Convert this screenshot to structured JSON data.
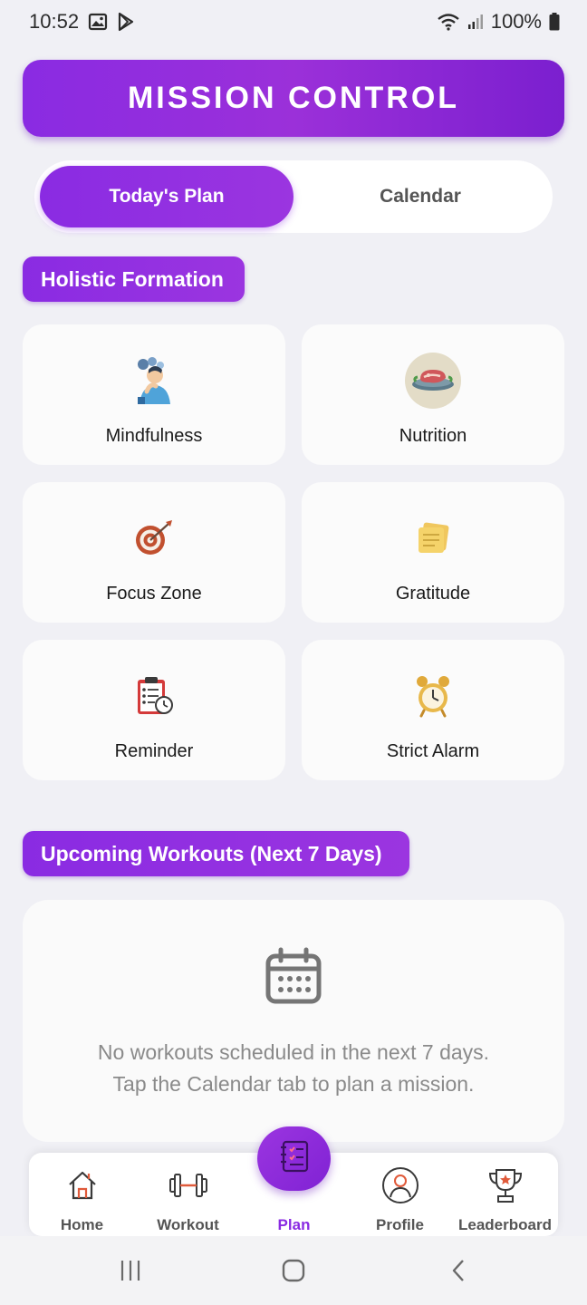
{
  "status_bar": {
    "time": "10:52",
    "battery": "100%",
    "icons": [
      "gallery-icon",
      "play-store-icon",
      "wifi-icon",
      "signal-icon",
      "battery-icon"
    ]
  },
  "header": {
    "title": "MISSION CONTROL"
  },
  "tabs": {
    "items": [
      {
        "label": "Today's Plan",
        "active": true
      },
      {
        "label": "Calendar",
        "active": false
      }
    ]
  },
  "holistic": {
    "section_title": "Holistic Formation",
    "tiles": [
      {
        "label": "Mindfulness",
        "icon": "meditation-person-icon"
      },
      {
        "label": "Nutrition",
        "icon": "steak-plate-icon"
      },
      {
        "label": "Focus Zone",
        "icon": "target-arrow-icon"
      },
      {
        "label": "Gratitude",
        "icon": "sticky-notes-icon"
      },
      {
        "label": "Reminder",
        "icon": "clipboard-clock-icon"
      },
      {
        "label": "Strict Alarm",
        "icon": "alarm-clock-icon"
      }
    ]
  },
  "upcoming": {
    "section_title": "Upcoming Workouts (Next 7 Days)",
    "empty_line1": "No workouts scheduled in the next 7 days.",
    "empty_line2": "Tap the Calendar tab to plan a mission.",
    "icon": "calendar-icon"
  },
  "bottom_nav": {
    "items": [
      {
        "label": "Home",
        "icon": "home-icon",
        "active": false
      },
      {
        "label": "Workout",
        "icon": "dumbbell-icon",
        "active": false
      },
      {
        "label": "Plan",
        "icon": "plan-notebook-icon",
        "active": true
      },
      {
        "label": "Profile",
        "icon": "profile-icon",
        "active": false
      },
      {
        "label": "Leaderboard",
        "icon": "trophy-icon",
        "active": false
      }
    ]
  },
  "colors": {
    "accent": "#8a2be2",
    "background": "#f0f0f5",
    "card": "#fbfbfb",
    "muted_text": "#8a8a8a"
  }
}
